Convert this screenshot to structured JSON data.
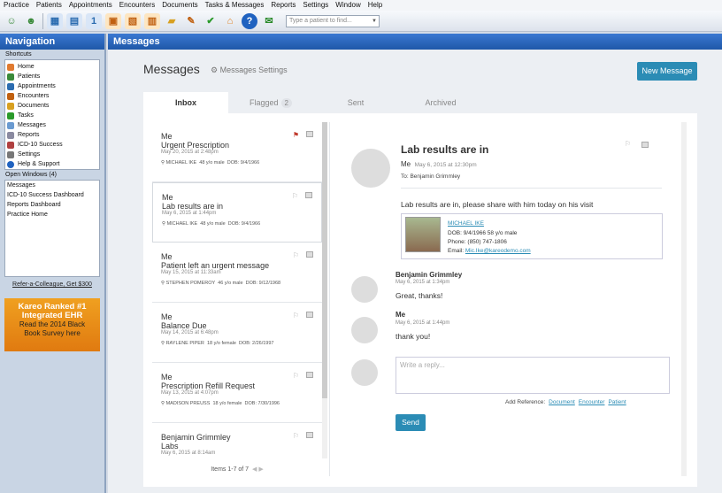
{
  "menu": [
    "Practice",
    "Patients",
    "Appointments",
    "Encounters",
    "Documents",
    "Tasks & Messages",
    "Reports",
    "Settings",
    "Window",
    "Help"
  ],
  "toolbar": {
    "search_placeholder": "Type a patient to find..."
  },
  "nav": {
    "title": "Navigation",
    "shortcuts_label": "Shortcuts",
    "shortcuts": [
      "Home",
      "Patients",
      "Appointments",
      "Encounters",
      "Documents",
      "Tasks",
      "Messages",
      "Reports",
      "ICD-10 Success",
      "Settings",
      "Help & Support"
    ],
    "open_windows_label": "Open Windows (4)",
    "open_windows": [
      "Messages",
      "ICD-10 Success Dashboard",
      "Reports Dashboard",
      "Practice Home"
    ],
    "refer": "Refer-a-Colleague, Get $300",
    "ad": {
      "line1": "Kareo Ranked #1",
      "line2": "Integrated EHR",
      "line3": "Read the 2014 Black",
      "line4": "Book Survey here"
    }
  },
  "main": {
    "header": "Messages",
    "page_title": "Messages",
    "settings_label": "Messages Settings",
    "new_message": "New Message",
    "tabs": [
      {
        "label": "Inbox"
      },
      {
        "label": "Flagged",
        "badge": "2"
      },
      {
        "label": "Sent"
      },
      {
        "label": "Archived"
      }
    ]
  },
  "messages": [
    {
      "from": "Me",
      "subject": "Urgent Prescription",
      "time": "May 20, 2015 at 2:48pm",
      "patient": "MICHAEL IKE",
      "age": "48 y/o male",
      "dob": "DOB: 9/4/1966"
    },
    {
      "from": "Me",
      "subject": "Lab results are in",
      "time": "May 6, 2015 at 1:44pm",
      "patient": "MICHAEL IKE",
      "age": "48 y/o male",
      "dob": "DOB: 9/4/1966"
    },
    {
      "from": "Me",
      "subject": "Patient left an urgent message",
      "time": "May 15, 2015 at 11:33am",
      "patient": "STEPHEN POMEROY",
      "age": "46 y/o male",
      "dob": "DOB: 9/12/1968"
    },
    {
      "from": "Me",
      "subject": "Balance Due",
      "time": "May 14, 2015 at 6:48pm",
      "patient": "RAYLENE PIPER",
      "age": "18 y/o female",
      "dob": "DOB: 2/26/1997"
    },
    {
      "from": "Me",
      "subject": "Prescription Refill Request",
      "time": "May 13, 2015 at 4:07pm",
      "patient": "MADISON PREUSS",
      "age": "18 y/o female",
      "dob": "DOB: 7/30/1996"
    },
    {
      "from": "Benjamin Grimmley",
      "subject": "Labs",
      "time": "May 6, 2015 at 8:14am",
      "patient": "",
      "age": "",
      "dob": ""
    }
  ],
  "pager": "Items 1-7 of 7",
  "detail": {
    "title": "Lab results are in",
    "from": "Me",
    "time": "May 6, 2015 at 12:30pm",
    "to": "To: Benjamin Grimmley",
    "body": "Lab results are in, please share with him today on his visit",
    "card": {
      "name": "MICHAEL IKE",
      "dob": "DOB: 9/4/1966 58 y/o male",
      "phone": "Phone: (850) 747-1806",
      "email_label": "Email: ",
      "email": "Mic.Ike@kareodemo.com"
    },
    "replies": [
      {
        "name": "Benjamin Grimmley",
        "time": "May 6, 2015 at 1:34pm",
        "text": "Great, thanks!"
      },
      {
        "name": "Me",
        "time": "May 6, 2015 at 1:44pm",
        "text": "thank you!"
      }
    ],
    "reply_placeholder": "Write a reply...",
    "add_reference": "Add Reference:",
    "ref_document": "Document",
    "ref_encounter": "Encounter",
    "ref_patient": "Patient",
    "send": "Send"
  }
}
